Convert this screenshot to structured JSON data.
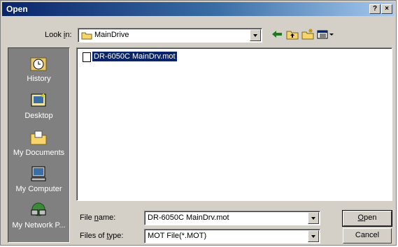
{
  "window": {
    "title": "Open",
    "help_button": "?",
    "close_button": "×"
  },
  "look_in": {
    "label_pre": "Look ",
    "label_accel": "i",
    "label_post": "n:",
    "value": "MainDrive"
  },
  "toolbar": [
    "back-icon",
    "up-folder-icon",
    "new-folder-icon",
    "view-menu-icon"
  ],
  "places": [
    {
      "label": "History",
      "icon": "history-icon"
    },
    {
      "label": "Desktop",
      "icon": "desktop-icon"
    },
    {
      "label": "My Documents",
      "icon": "my-documents-icon"
    },
    {
      "label": "My Computer",
      "icon": "my-computer-icon"
    },
    {
      "label": "My Network P...",
      "icon": "my-network-places-icon"
    }
  ],
  "files": [
    {
      "name": "DR-6050C MainDrv.mot",
      "selected": true
    }
  ],
  "file_name": {
    "label_pre": "File ",
    "label_accel": "n",
    "label_post": "ame:",
    "value": "DR-6050C MainDrv.mot"
  },
  "file_type": {
    "label_pre": "Files of ",
    "label_accel": "t",
    "label_post": "ype:",
    "value": "MOT File(*.MOT)"
  },
  "buttons": {
    "open_accel": "O",
    "open_rest": "pen",
    "cancel": "Cancel"
  },
  "colors": {
    "title_start": "#0a246a",
    "title_end": "#a6caf0",
    "face": "#d4d0c8",
    "places_bg": "#808080",
    "selection": "#0a246a"
  }
}
